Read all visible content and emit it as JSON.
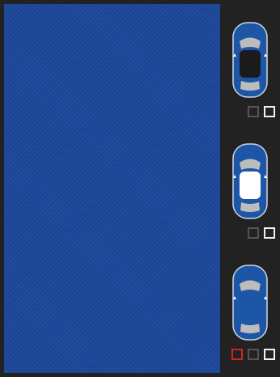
{
  "colors": {
    "body_blue": "#1d4aa0",
    "body_white": "#ffffff",
    "panel_bg": "#222222",
    "mark_red": "#d32222",
    "mark_gray": "#555555",
    "mark_white": "#f2f2f2"
  },
  "options": [
    {
      "name": "blue-body-dark-roof",
      "body": "#1d56a6",
      "roof": "#1b1b1b",
      "marks": [
        "gray",
        "white"
      ]
    },
    {
      "name": "blue-body-white-roof",
      "body": "#1d56a6",
      "roof": "#ffffff",
      "marks": [
        "gray",
        "white"
      ]
    },
    {
      "name": "blue-body-blue-roof",
      "body": "#1d56a6",
      "roof": "#1d56a6",
      "marks": [
        "red",
        "gray",
        "white"
      ]
    }
  ]
}
